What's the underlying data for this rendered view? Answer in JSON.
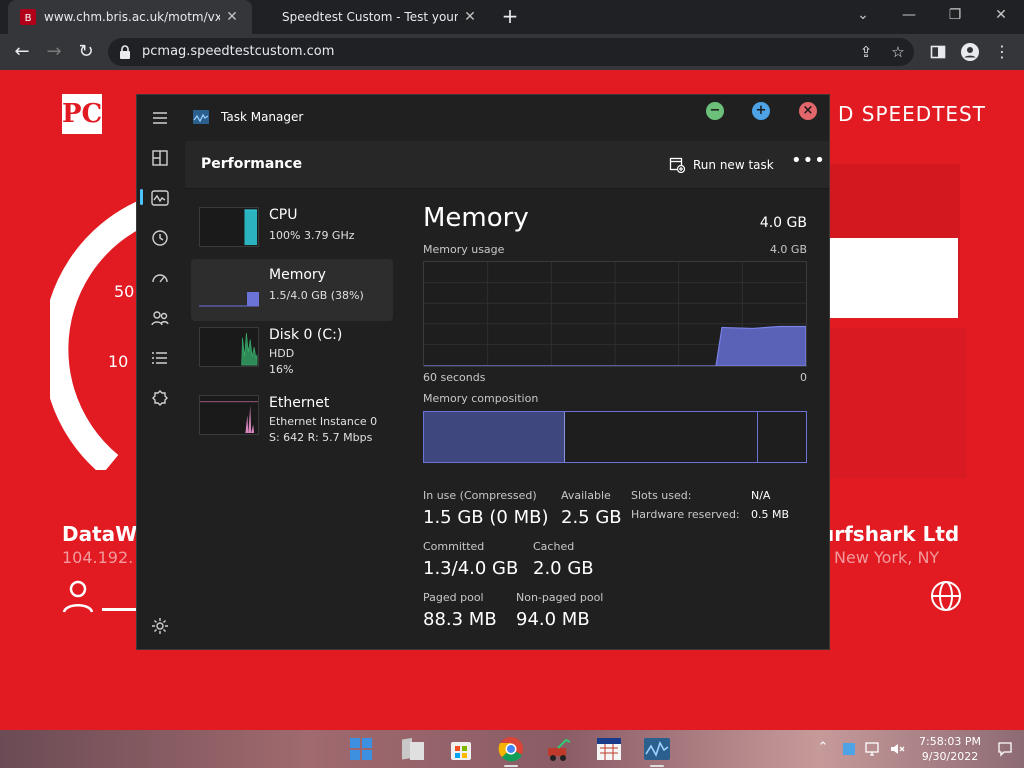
{
  "browser": {
    "tabs": [
      {
        "title": "www.chm.bris.ac.uk/motm/vx/vx.htm",
        "active": true
      },
      {
        "title": "Speedtest Custom - Test your internet",
        "active": false
      }
    ],
    "new_tab": "+",
    "url": "pcmag.speedtestcustom.com",
    "win_controls": {
      "minimize": "—",
      "restore": "❐",
      "close": "✕"
    }
  },
  "page": {
    "logo": "PC",
    "brand": "D SPEEDTEST",
    "gauge_labels": [
      "50",
      "10"
    ],
    "isp_left": "DataW",
    "ip_left": "104.192.",
    "isp_right": "urfshark Ltd",
    "location_right": "New York, NY",
    "colors": {
      "background": "#e21a22",
      "text": "#ffffff"
    }
  },
  "task_manager": {
    "title": "Task Manager",
    "header": "Performance",
    "run_new_task": "Run new task",
    "more": "•••",
    "window_buttons": {
      "minimize": "−",
      "maximize": "+",
      "close": "×"
    },
    "items": [
      {
        "name": "CPU",
        "line1": "100%  3.79 GHz",
        "line2": "",
        "line3": ""
      },
      {
        "name": "Memory",
        "line1": "1.5/4.0 GB (38%)",
        "line2": "",
        "line3": ""
      },
      {
        "name": "Disk 0 (C:)",
        "line1": "HDD",
        "line2": "16%",
        "line3": ""
      },
      {
        "name": "Ethernet",
        "line1": "Ethernet Instance 0",
        "line2": "S: 642  R: 5.7 Mbps",
        "line3": ""
      }
    ],
    "detail": {
      "title": "Memory",
      "total": "4.0 GB",
      "usage_label": "Memory usage",
      "usage_max": "4.0 GB",
      "time_label": "60 seconds",
      "time_zero": "0",
      "composition_label": "Memory composition",
      "usage_level": 0.38,
      "composition": {
        "in_use": 0.37,
        "modified": 0.005,
        "standby": 0.5,
        "free": 0.125
      },
      "stats": {
        "in_use_label": "In use (Compressed)",
        "in_use_value": "1.5 GB (0 MB)",
        "available_label": "Available",
        "available_value": "2.5 GB",
        "committed_label": "Committed",
        "committed_value": "1.3/4.0 GB",
        "cached_label": "Cached",
        "cached_value": "2.0 GB",
        "paged_label": "Paged pool",
        "paged_value": "88.3 MB",
        "nonpaged_label": "Non-paged pool",
        "nonpaged_value": "94.0 MB",
        "slots_label": "Slots used:",
        "slots_value": "N/A",
        "hw_label": "Hardware reserved:",
        "hw_value": "0.5 MB"
      },
      "accent": "#6b73d6"
    }
  },
  "taskbar": {
    "time": "7:58:03 PM",
    "date": "9/30/2022",
    "apps": [
      "windows-start",
      "file-explorer",
      "microsoft-store",
      "chrome",
      "game-app",
      "calendar-app",
      "task-manager"
    ]
  }
}
